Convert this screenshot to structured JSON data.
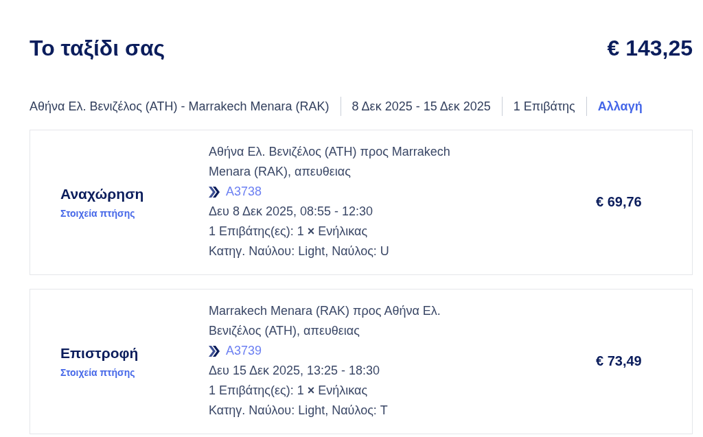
{
  "header": {
    "title": "Το ταξίδι σας",
    "total_price": "€ 143,25"
  },
  "summary": {
    "route": "Αθήνα Ελ. Βενιζέλος (ATH) - Marrakech Menara (RAK)",
    "dates": "8 Δεκ 2025 - 15 Δεκ 2025",
    "passengers": "1 Επιβάτης",
    "change_link": "Αλλαγή"
  },
  "flights": [
    {
      "direction": "Αναχώρηση",
      "details_link": "Στοιχεία πτήσης",
      "route": "Αθήνα Ελ. Βενιζέλος (ATH) προς Marrakech Menara (RAK), απευθειας",
      "flight_number": "A3738",
      "datetime": "Δευ 8 Δεκ 2025, 08:55 - 12:30",
      "passengers": "1 Επιβάτης(ες): 1 **×** Ενήλικας",
      "fare": "Κατηγ. Ναύλου: Light, Ναύλος: U",
      "price": "€ 69,76"
    },
    {
      "direction": "Επιστροφή",
      "details_link": "Στοιχεία πτήσης",
      "route": "Marrakech Menara (RAK) προς Αθήνα Ελ. Βενιζέλος (ATH), απευθειας",
      "flight_number": "A3739",
      "datetime": "Δευ 15 Δεκ 2025, 13:25 - 18:30",
      "passengers": "1 Επιβάτης(ες): 1 **×** Ενήλικας",
      "fare": "Κατηγ. Ναύλου: Light, Ναύλος: T",
      "price": "€ 73,49"
    }
  ]
}
